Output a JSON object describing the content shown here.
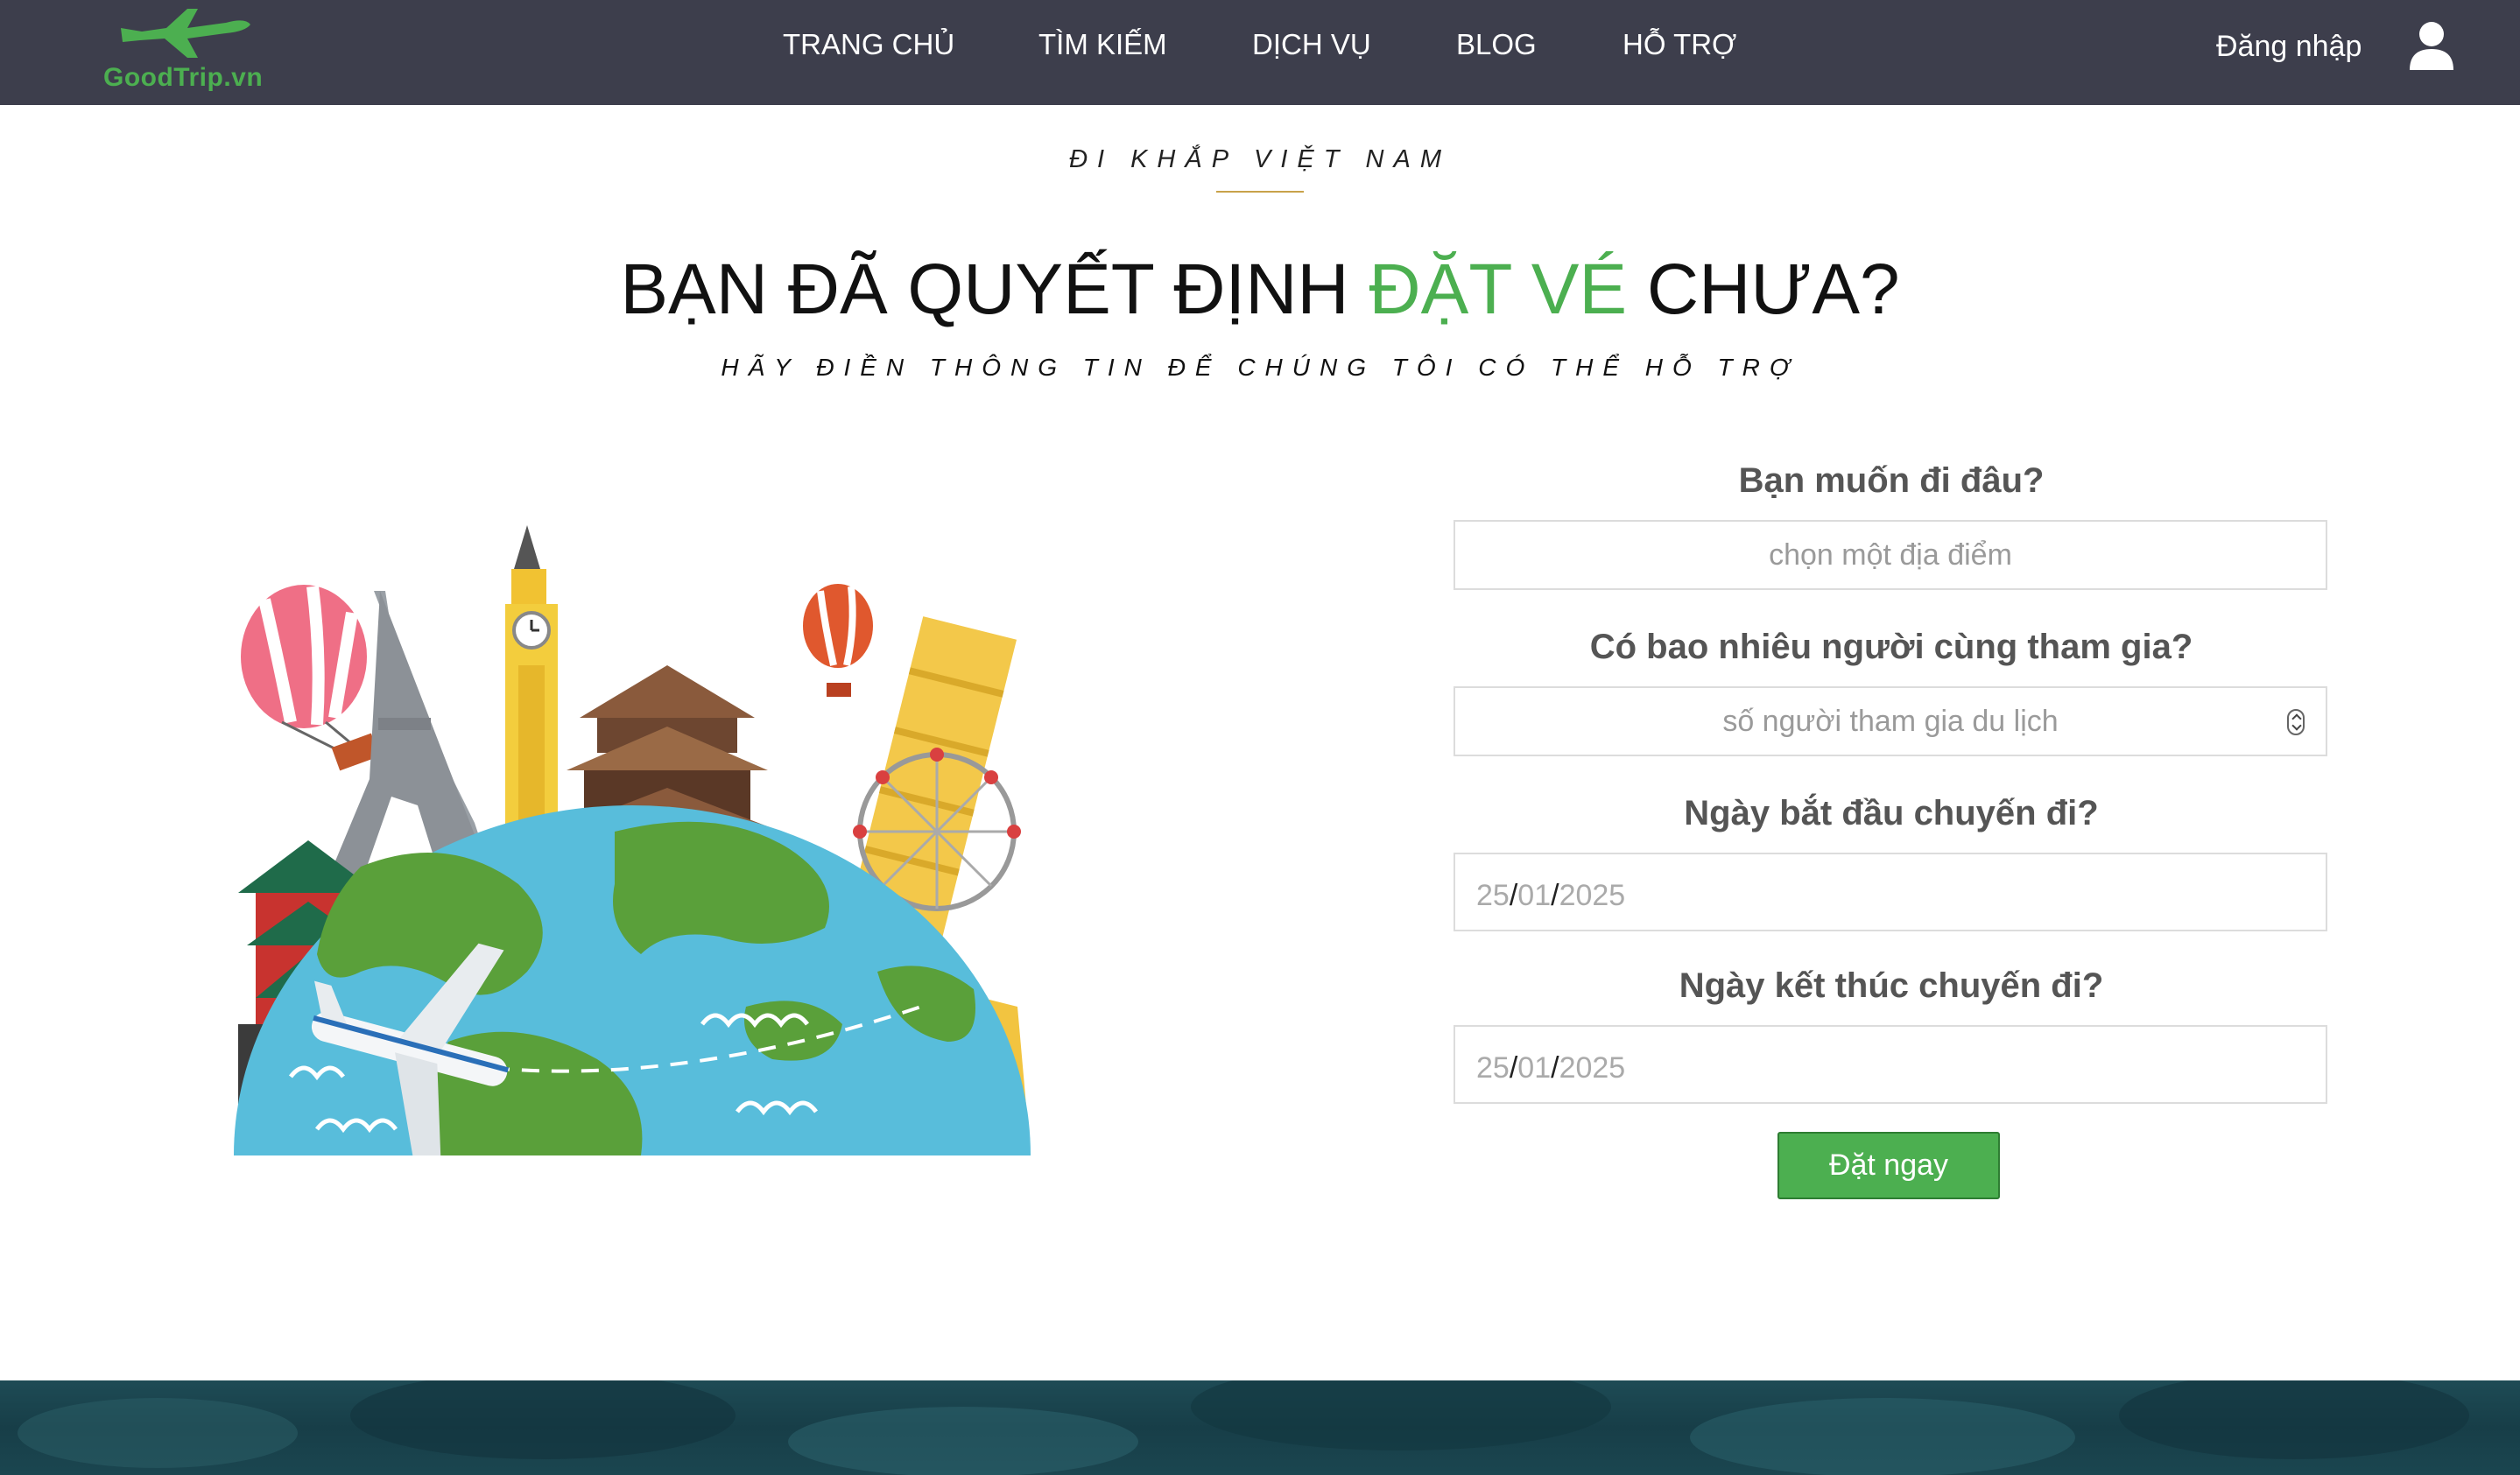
{
  "brand": {
    "name": "GoodTrip.vn",
    "logo_icon": "airplane-icon",
    "color": "#4caf50"
  },
  "nav": {
    "items": [
      "TRANG CHỦ",
      "TÌM KIẾM",
      "DỊCH VỤ",
      "BLOG",
      "HỖ TRỢ"
    ],
    "login_label": "Đăng nhập",
    "user_icon": "user-icon",
    "background": "#3d3e4c"
  },
  "hero": {
    "eyebrow": "ĐI KHẮP VIỆT NAM",
    "headline_start": "BẠN ĐÃ QUYẾT ĐỊNH ",
    "headline_accent": "ĐẶT VÉ",
    "headline_end": " CHƯA?",
    "subheadline": "HÃY ĐIỀN THÔNG TIN ĐỂ CHÚNG TÔI CÓ THỂ HỖ TRỢ",
    "accent_color": "#4caf50"
  },
  "form": {
    "destination_label": "Bạn muốn đi đâu?",
    "destination_placeholder": "chọn một địa điểm",
    "people_label": "Có bao nhiêu người cùng tham gia?",
    "people_placeholder": "số người tham gia du lịch",
    "start_label": "Ngày bắt đầu chuyến đi?",
    "start_day": "25",
    "start_month": "01",
    "start_year": "2025",
    "end_label": "Ngày kết thúc chuyến đi?",
    "end_day": "25",
    "end_month": "01",
    "end_year": "2025",
    "date_separator": "/",
    "submit_label": "Đặt ngay",
    "submit_color": "#4caf50"
  }
}
